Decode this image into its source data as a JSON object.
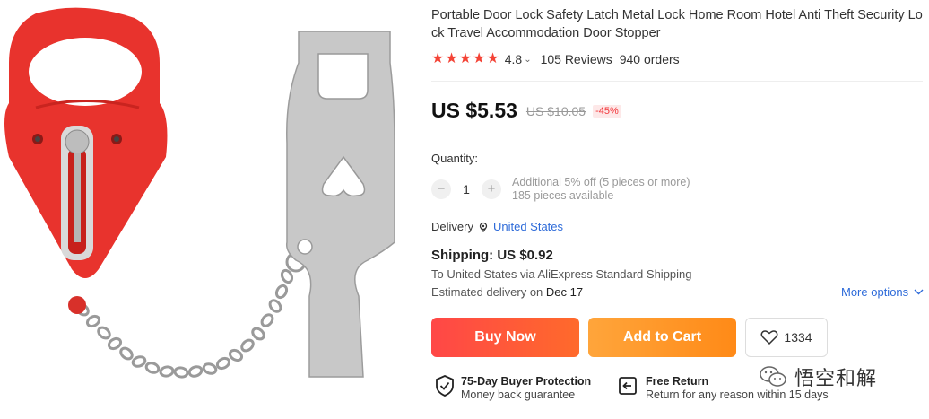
{
  "product": {
    "title": "Portable Door Lock Safety Latch Metal Lock Home Room Hotel Anti Theft Security Lock Travel Accommodation Door Stopper"
  },
  "rating": {
    "stars": 5,
    "score": "4.8",
    "reviews": "105 Reviews",
    "orders": "940 orders"
  },
  "price": {
    "current": "US $5.53",
    "original": "US $10.05",
    "discount": "-45%"
  },
  "quantity": {
    "label": "Quantity:",
    "value": "1",
    "minus": "−",
    "plus": "+",
    "info_line1": "Additional 5% off (5 pieces or more)",
    "info_line2": "185 pieces available"
  },
  "delivery": {
    "label": "Delivery",
    "country": "United States"
  },
  "shipping": {
    "title": "Shipping: US $0.92",
    "line1": "To United States via AliExpress Standard Shipping",
    "line2_prefix": "Estimated delivery on",
    "line2_date": "Dec 17",
    "more_options": "More options"
  },
  "actions": {
    "buy_now": "Buy Now",
    "add_to_cart": "Add to Cart",
    "wishlist_count": "1334"
  },
  "guarantees": {
    "protection_title": "75-Day Buyer Protection",
    "protection_sub": "Money back guarantee",
    "return_title": "Free Return",
    "return_sub": "Return for any reason within 15 days"
  },
  "watermark": {
    "text": "悟空和解"
  },
  "colors": {
    "accent_red": "#ff4747",
    "accent_orange": "#ff8a17",
    "link_blue": "#2e6bd9",
    "star_red": "#f44336"
  }
}
